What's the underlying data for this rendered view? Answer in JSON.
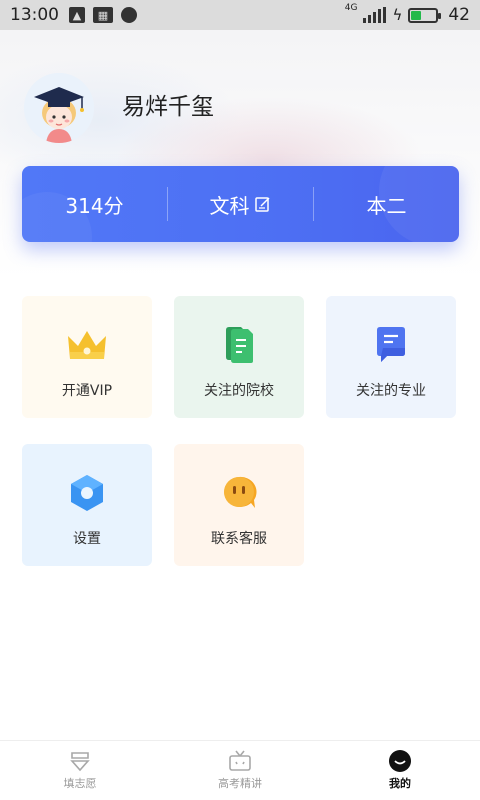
{
  "status_bar": {
    "time": "13:00",
    "network": "4G",
    "battery": "42",
    "battery_color": "#22b94a"
  },
  "profile": {
    "username": "易烊千玺",
    "avatar_icon": "graduate-avatar-icon"
  },
  "score_card": {
    "score": "314分",
    "subject": "文科",
    "batch": "本二",
    "edit_icon": "edit-icon",
    "accent": "#4f73f5"
  },
  "menu": {
    "items": [
      {
        "label": "开通VIP",
        "icon": "crown-icon",
        "color": "#f5c02e"
      },
      {
        "label": "关注的院校",
        "icon": "document-icon",
        "color": "#3dbf6f"
      },
      {
        "label": "关注的专业",
        "icon": "note-icon",
        "color": "#4f74f0"
      },
      {
        "label": "设置",
        "icon": "hexagon-gear-icon",
        "color": "#3a94f2"
      },
      {
        "label": "联系客服",
        "icon": "chat-face-icon",
        "color": "#f6a623"
      }
    ]
  },
  "bottom_nav": {
    "items": [
      {
        "label": "填志愿",
        "icon": "form-icon",
        "active": false
      },
      {
        "label": "高考精讲",
        "icon": "tv-icon",
        "active": false
      },
      {
        "label": "我的",
        "icon": "smile-icon",
        "active": true
      }
    ]
  }
}
